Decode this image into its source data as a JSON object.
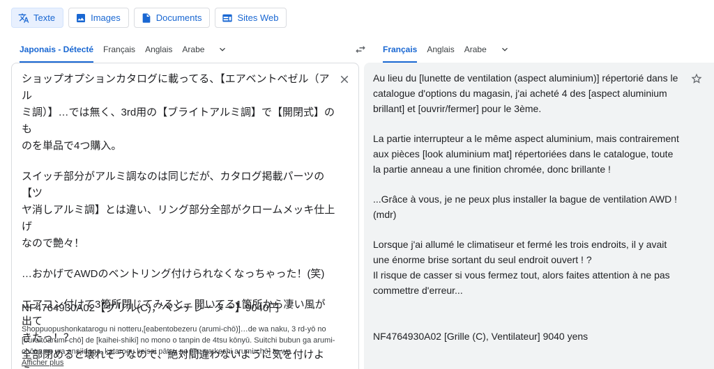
{
  "modes": [
    {
      "label": "Texte",
      "icon": "translate-icon",
      "active": true
    },
    {
      "label": "Images",
      "icon": "image-icon",
      "active": false
    },
    {
      "label": "Documents",
      "icon": "document-icon",
      "active": false
    },
    {
      "label": "Sites Web",
      "icon": "website-icon",
      "active": false
    }
  ],
  "source_langs": [
    "Japonais - Détecté",
    "Français",
    "Anglais",
    "Arabe"
  ],
  "target_langs": [
    "Français",
    "Anglais",
    "Arabe"
  ],
  "source": {
    "lines": [
      "ショップオプションカタログに載ってる、【エアベントベゼル（アル",
      "ミ調）】…では無く、3rd用の【ブライトアルミ調】で【開閉式】のも",
      "のを単品で4つ購入。",
      "",
      "スイッチ部分がアルミ調なのは同じだが、カタログ掲載パーツの【ツ",
      "ヤ消しアルミ調】とは違い、リング部分全部がクロームメッキ仕上げ",
      "なので艶々！",
      "",
      "…おかげでAWDのベントリング付けられなくなっちゃった！(笑)",
      "",
      "エアコン付けて3箇所閉じてみると、開いてる1箇所から凄い風が出て",
      "きたっ！？",
      "全部閉めると壊れそうなので、絶対間違わないように気を付けよう…"
    ],
    "product": "NF4764930A02【グリル(C)，ベンチレーター】9040円",
    "romaji": "Shoppuopushonkatarogu ni notteru,[eabentobezeru (arumi-chō)]…de wa naku, 3 rd-yō no [buraitoarumi-chō] de [kaihei-shiki] no mono o tanpin de 4tsu kōnyū. Suitchi bubun ga arumi-chōna no wa onajidaga, katarogu keisai pātsu no [Tsuya keshi arumi-chō] to wa",
    "more": "Afficher plus"
  },
  "target": {
    "lines": [
      "Au lieu du [lunette de ventilation (aspect aluminium)] répertorié dans le",
      "catalogue d'options du magasin, j'ai acheté 4 des [aspect aluminium",
      "brillant] et [ouvrir/fermer] pour le 3ème.",
      "",
      "La partie interrupteur a le même aspect aluminium, mais contrairement",
      "aux pièces [look aluminium mat] répertoriées dans le catalogue, toute",
      "la partie anneau a une finition chromée, donc brillante !",
      "",
      "...Grâce à vous, je ne peux plus installer la bague de ventilation AWD !",
      "(mdr)",
      "",
      "Lorsque j'ai allumé le climatiseur et fermé les trois endroits, il y avait",
      "une énorme brise sortant du seul endroit ouvert ! ?",
      "Il risque de casser si vous fermez tout, alors faites attention à ne pas",
      "commettre d'erreur..."
    ],
    "product": "NF4764930A02 [Grille (C), Ventilateur] 9040 yens"
  },
  "colors": {
    "accent": "#1967d2",
    "target_bg": "#f1f3f4"
  }
}
